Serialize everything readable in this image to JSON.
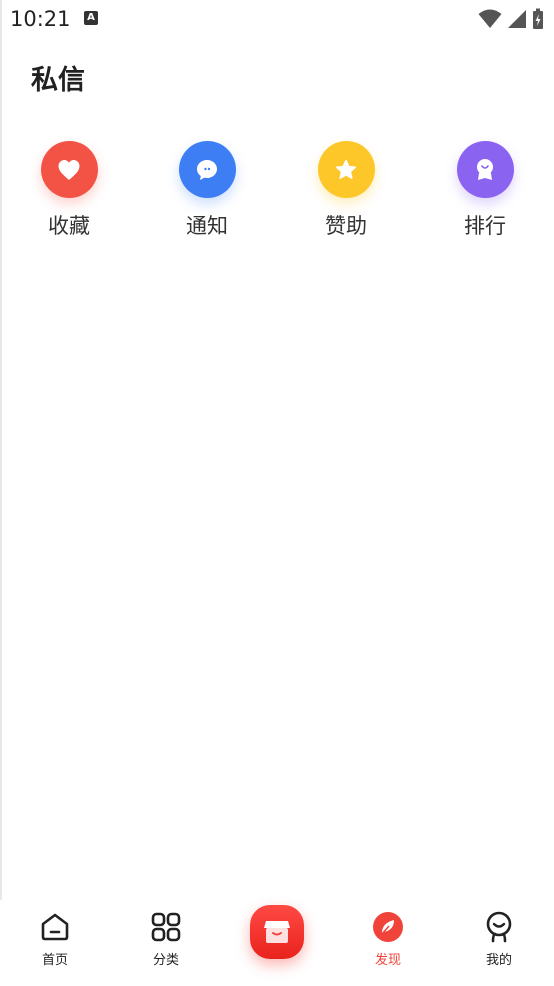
{
  "status_bar": {
    "time": "10:21",
    "notification_icon": "a-icon",
    "right_icons": [
      "wifi-icon",
      "signal-icon",
      "battery-icon"
    ]
  },
  "header": {
    "title": "私信"
  },
  "quick_actions": [
    {
      "label": "收藏",
      "icon": "heart-icon",
      "color": "#f25344"
    },
    {
      "label": "通知",
      "icon": "chat-bubble-icon",
      "color": "#3d7ef5"
    },
    {
      "label": "赞助",
      "icon": "star-icon",
      "color": "#fdc72a"
    },
    {
      "label": "排行",
      "icon": "medal-icon",
      "color": "#8b63f1"
    }
  ],
  "bottom_nav": {
    "items": [
      {
        "label": "首页",
        "icon": "home-icon",
        "active": false
      },
      {
        "label": "分类",
        "icon": "grid-icon",
        "active": false
      },
      {
        "label": "",
        "icon": "store-icon",
        "center": true
      },
      {
        "label": "发现",
        "icon": "leaf-icon",
        "active": true
      },
      {
        "label": "我的",
        "icon": "smile-person-icon",
        "active": false
      }
    ],
    "active_color": "#f0433a"
  }
}
